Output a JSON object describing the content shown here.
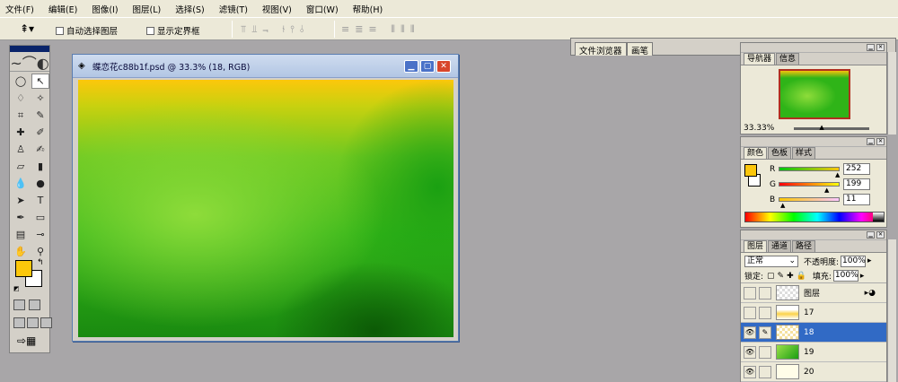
{
  "menu": [
    "文件(F)",
    "编辑(E)",
    "图像(I)",
    "图层(L)",
    "选择(S)",
    "滤镜(T)",
    "视图(V)",
    "窗口(W)",
    "帮助(H)"
  ],
  "options": {
    "tool_preset_icon": "move-tool-icon",
    "auto_select": "自动选择图层",
    "show_bounds": "显示定界框"
  },
  "dock_tabs": [
    "文件浏览器",
    "画笔"
  ],
  "document": {
    "title": "蝶恋花c88b1f.psd @ 33.3% (18, RGB)",
    "colors": {
      "top": "#fcc70b",
      "center": "#8edc3a",
      "bottom": "#1a8a10"
    }
  },
  "navigator": {
    "tabs": [
      "导航器",
      "信息"
    ],
    "zoom": "33.33%"
  },
  "color_panel": {
    "tabs": [
      "颜色",
      "色板",
      "样式"
    ],
    "foreground": "#fcc70b",
    "channels": [
      {
        "label": "R",
        "value": "252"
      },
      {
        "label": "G",
        "value": "199"
      },
      {
        "label": "B",
        "value": "11"
      }
    ]
  },
  "layers_panel": {
    "tabs": [
      "图层",
      "通道",
      "路径"
    ],
    "blend_mode": "正常",
    "opacity_label": "不透明度:",
    "opacity": "100%",
    "lock_label": "锁定:",
    "fill_label": "填充:",
    "fill": "100%",
    "layers": [
      {
        "name": "图层",
        "thumb": "checker",
        "visible": false,
        "selected": false,
        "fx": true
      },
      {
        "name": "17",
        "thumb": "yel",
        "visible": false,
        "selected": false
      },
      {
        "name": "18",
        "thumb": "yel2",
        "visible": true,
        "selected": true
      },
      {
        "name": "19",
        "thumb": "green",
        "visible": true,
        "selected": false
      },
      {
        "name": "20",
        "thumb": "white",
        "visible": true,
        "selected": false
      }
    ]
  }
}
